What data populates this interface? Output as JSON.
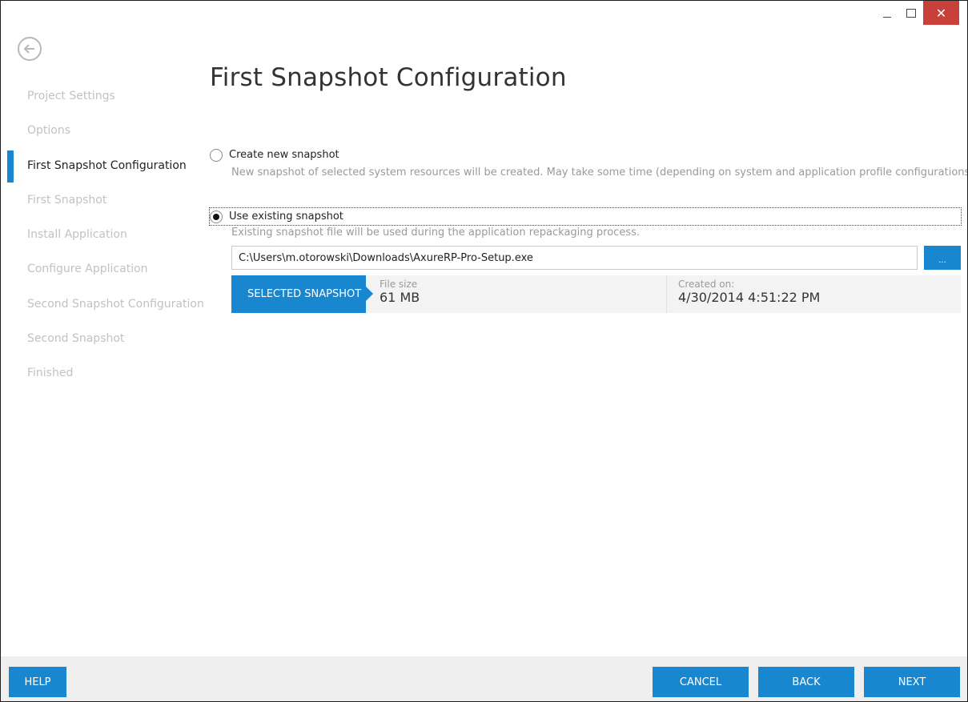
{
  "window": {
    "controls": {
      "minimize_icon": "minimize-icon",
      "maximize_icon": "maximize-icon",
      "close_glyph": "✕"
    }
  },
  "sidebar": {
    "back_icon": "back-arrow-icon",
    "items": [
      {
        "label": "Project Settings",
        "active": false
      },
      {
        "label": "Options",
        "active": false
      },
      {
        "label": "First Snapshot Configuration",
        "active": true
      },
      {
        "label": "First Snapshot",
        "active": false
      },
      {
        "label": "Install Application",
        "active": false
      },
      {
        "label": "Configure Application",
        "active": false
      },
      {
        "label": "Second Snapshot Configuration",
        "active": false
      },
      {
        "label": "Second Snapshot",
        "active": false
      },
      {
        "label": "Finished",
        "active": false
      }
    ]
  },
  "main": {
    "title": "First Snapshot Configuration",
    "options": [
      {
        "label": "Create new snapshot",
        "description": "New snapshot of selected system resources will be created. May take some time (depending on system and application profile configurations.",
        "selected": false
      },
      {
        "label": "Use existing snapshot",
        "description": "Existing snapshot file will be used during the application repackaging process.",
        "selected": true
      }
    ],
    "path_value": "C:\\Users\\m.otorowski\\Downloads\\AxureRP-Pro-Setup.exe",
    "browse_label": "...",
    "snapshot": {
      "label": "SELECTED SNAPSHOT",
      "size_label": "File size",
      "size_value": "61 MB",
      "created_label": "Created on:",
      "created_value": "4/30/2014 4:51:22 PM"
    }
  },
  "footer": {
    "help": "HELP",
    "cancel": "CANCEL",
    "back": "BACK",
    "next": "NEXT"
  },
  "colors": {
    "accent": "#1987d0",
    "close": "#c7403a",
    "inactive_text": "#c2c2c2"
  }
}
